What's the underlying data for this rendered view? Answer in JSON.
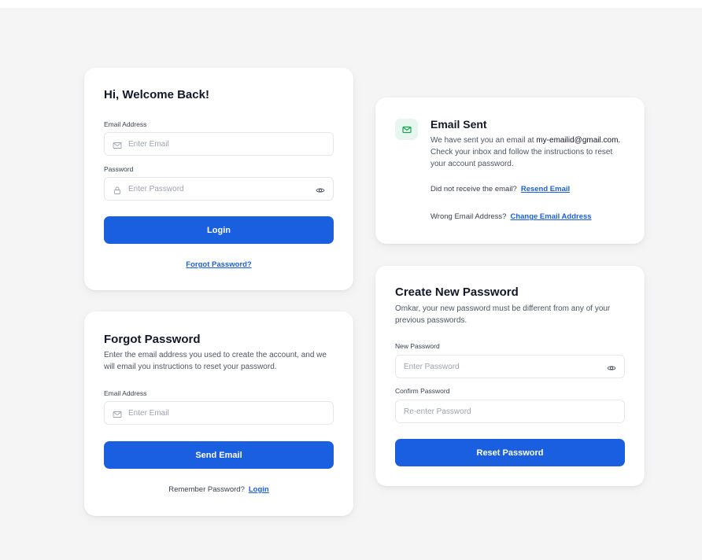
{
  "login": {
    "title": "Hi, Welcome Back!",
    "email_label": "Email Address",
    "email_placeholder": "Enter Email",
    "password_label": "Password",
    "password_placeholder": "Enter Password",
    "login_button": "Login",
    "forgot_link": "Forgot Password?"
  },
  "forgot": {
    "title": "Forgot Password",
    "description": "Enter the email address you used to create the account, and we will email you instructions to reset your password.",
    "email_label": "Email Address",
    "email_placeholder": "Enter Email",
    "send_button": "Send Email",
    "remember_text": "Remember Password?",
    "login_link": "Login"
  },
  "email_sent": {
    "title": "Email Sent",
    "desc_prefix": "We have sent you an email at",
    "email": "my-emailid@gmail.com.",
    "desc_suffix": "Check your inbox and follow the instructions to reset your account password.",
    "not_received_text": "Did not receive the email?",
    "resend_link": "Resend Email",
    "wrong_email_text": "Wrong Email Address?",
    "change_link": "Change Email Address"
  },
  "create_password": {
    "title": "Create New Password",
    "description": "Omkar, your new password must be different from any of your previous passwords.",
    "new_label": "New Password",
    "new_placeholder": "Enter Password",
    "confirm_label": "Confirm Password",
    "confirm_placeholder": "Re-enter Password",
    "reset_button": "Reset Password"
  },
  "colors": {
    "primary": "#1a5fe0",
    "background": "#f5f5f6",
    "card": "#ffffff",
    "success_badge": "#e7f6ee",
    "success_icon": "#16a34a"
  },
  "icons": {
    "email_field": "mail-icon",
    "password_field": "lock-icon",
    "password_toggle": "eye-icon",
    "email_sent_badge": "mail-icon"
  }
}
